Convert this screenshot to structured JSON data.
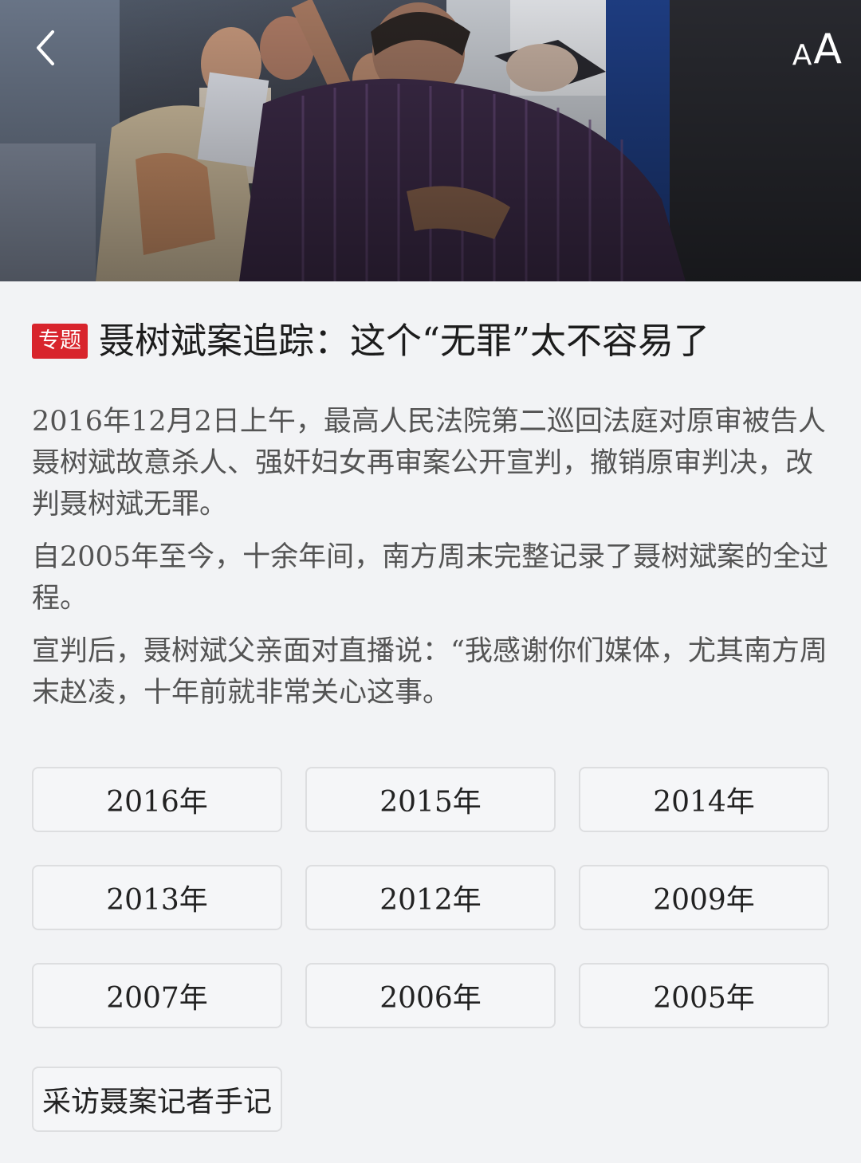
{
  "header": {
    "back_icon": "chevron-left-icon",
    "font_size_small": "A",
    "font_size_large": "A",
    "font_size_icon": "font-size-icon"
  },
  "article": {
    "tag": "专题",
    "title": "聂树斌案追踪：这个“无罪”太不容易了",
    "paragraphs": [
      "2016年12月2日上午，最高人民法院第二巡回法庭对原审被告人聂树斌故意杀人、强奸妇女再审案公开宣判，撤销原审判决，改判聂树斌无罪。",
      "自2005年至今，十余年间，南方周末完整记录了聂树斌案的全过程。",
      "宣判后，聂树斌父亲面对直播说：“我感谢你们媒体，尤其南方周末赵凌，十年前就非常关心这事。"
    ]
  },
  "years": [
    {
      "label": "2016年"
    },
    {
      "label": "2015年"
    },
    {
      "label": "2014年"
    },
    {
      "label": "2013年"
    },
    {
      "label": "2012年"
    },
    {
      "label": "2009年"
    },
    {
      "label": "2007年"
    },
    {
      "label": "2006年"
    },
    {
      "label": "2005年"
    }
  ],
  "notes_button": "采访聂案记者手记",
  "colors": {
    "tag_red": "#d8242c",
    "page_bg": "#f2f3f5",
    "body_text": "#545454"
  }
}
